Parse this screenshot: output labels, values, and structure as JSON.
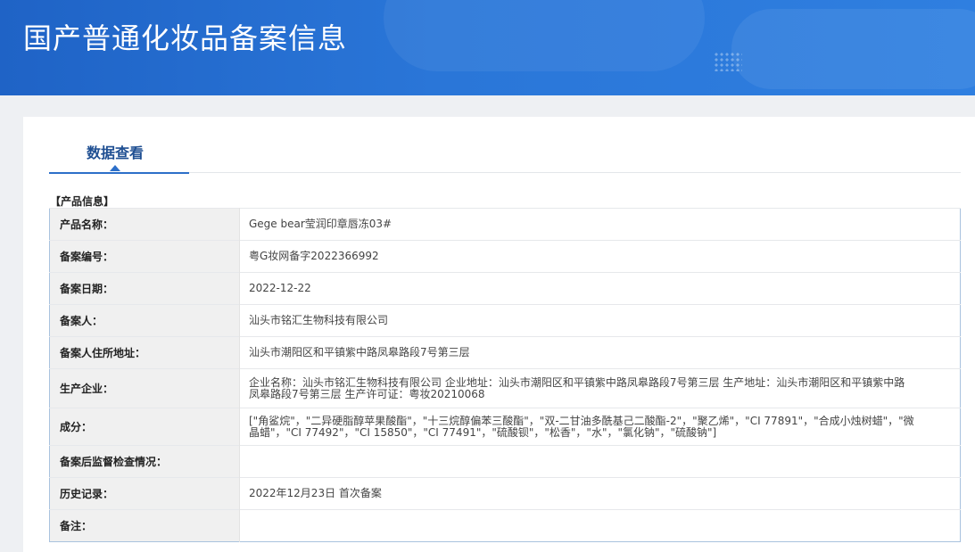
{
  "header": {
    "title": "国产普通化妆品备案信息"
  },
  "tabs": [
    {
      "label": "数据查看",
      "active": true
    }
  ],
  "section": {
    "label": "【产品信息】"
  },
  "rows": [
    {
      "label": "产品名称：",
      "value": "Gege bear莹润印章唇冻03#"
    },
    {
      "label": "备案编号：",
      "value": "粤G妆网备字2022366992"
    },
    {
      "label": "备案日期：",
      "value": "2022-12-22"
    },
    {
      "label": "备案人：",
      "value": "汕头市铭汇生物科技有限公司"
    },
    {
      "label": "备案人住所地址：",
      "value": "汕头市潮阳区和平镇紫中路凤皋路段7号第三层"
    },
    {
      "label": "生产企业：",
      "value": "企业名称：汕头市铭汇生物科技有限公司 企业地址：汕头市潮阳区和平镇紫中路凤皋路段7号第三层 生产地址：汕头市潮阳区和平镇紫中路凤皋路段7号第三层 生产许可证：粤妆20210068"
    },
    {
      "label": "成分：",
      "value": "[\"角鲨烷\"，\"二异硬脂醇苹果酸酯\"，\"十三烷醇偏苯三酸酯\"，\"双-二甘油多酰基己二酸酯-2\"，\"聚乙烯\"，\"CI 77891\"，\"合成小烛树蜡\"，\"微晶蜡\"，\"CI 77492\"，\"CI 15850\"，\"CI 77491\"，\"硫酸钡\"，\"松香\"，\"水\"，\"氯化钠\"，\"硫酸钠\"]"
    },
    {
      "label": "备案后监督检查情况：",
      "value": ""
    },
    {
      "label": "历史记录：",
      "value": "2022年12月23日 首次备案"
    },
    {
      "label": "备注：",
      "value": ""
    }
  ],
  "colors": {
    "banner": "#2a76d8",
    "tab_accent": "#2c6fc9",
    "tab_text": "#1f4f92",
    "table_border": "#a9c2de"
  }
}
